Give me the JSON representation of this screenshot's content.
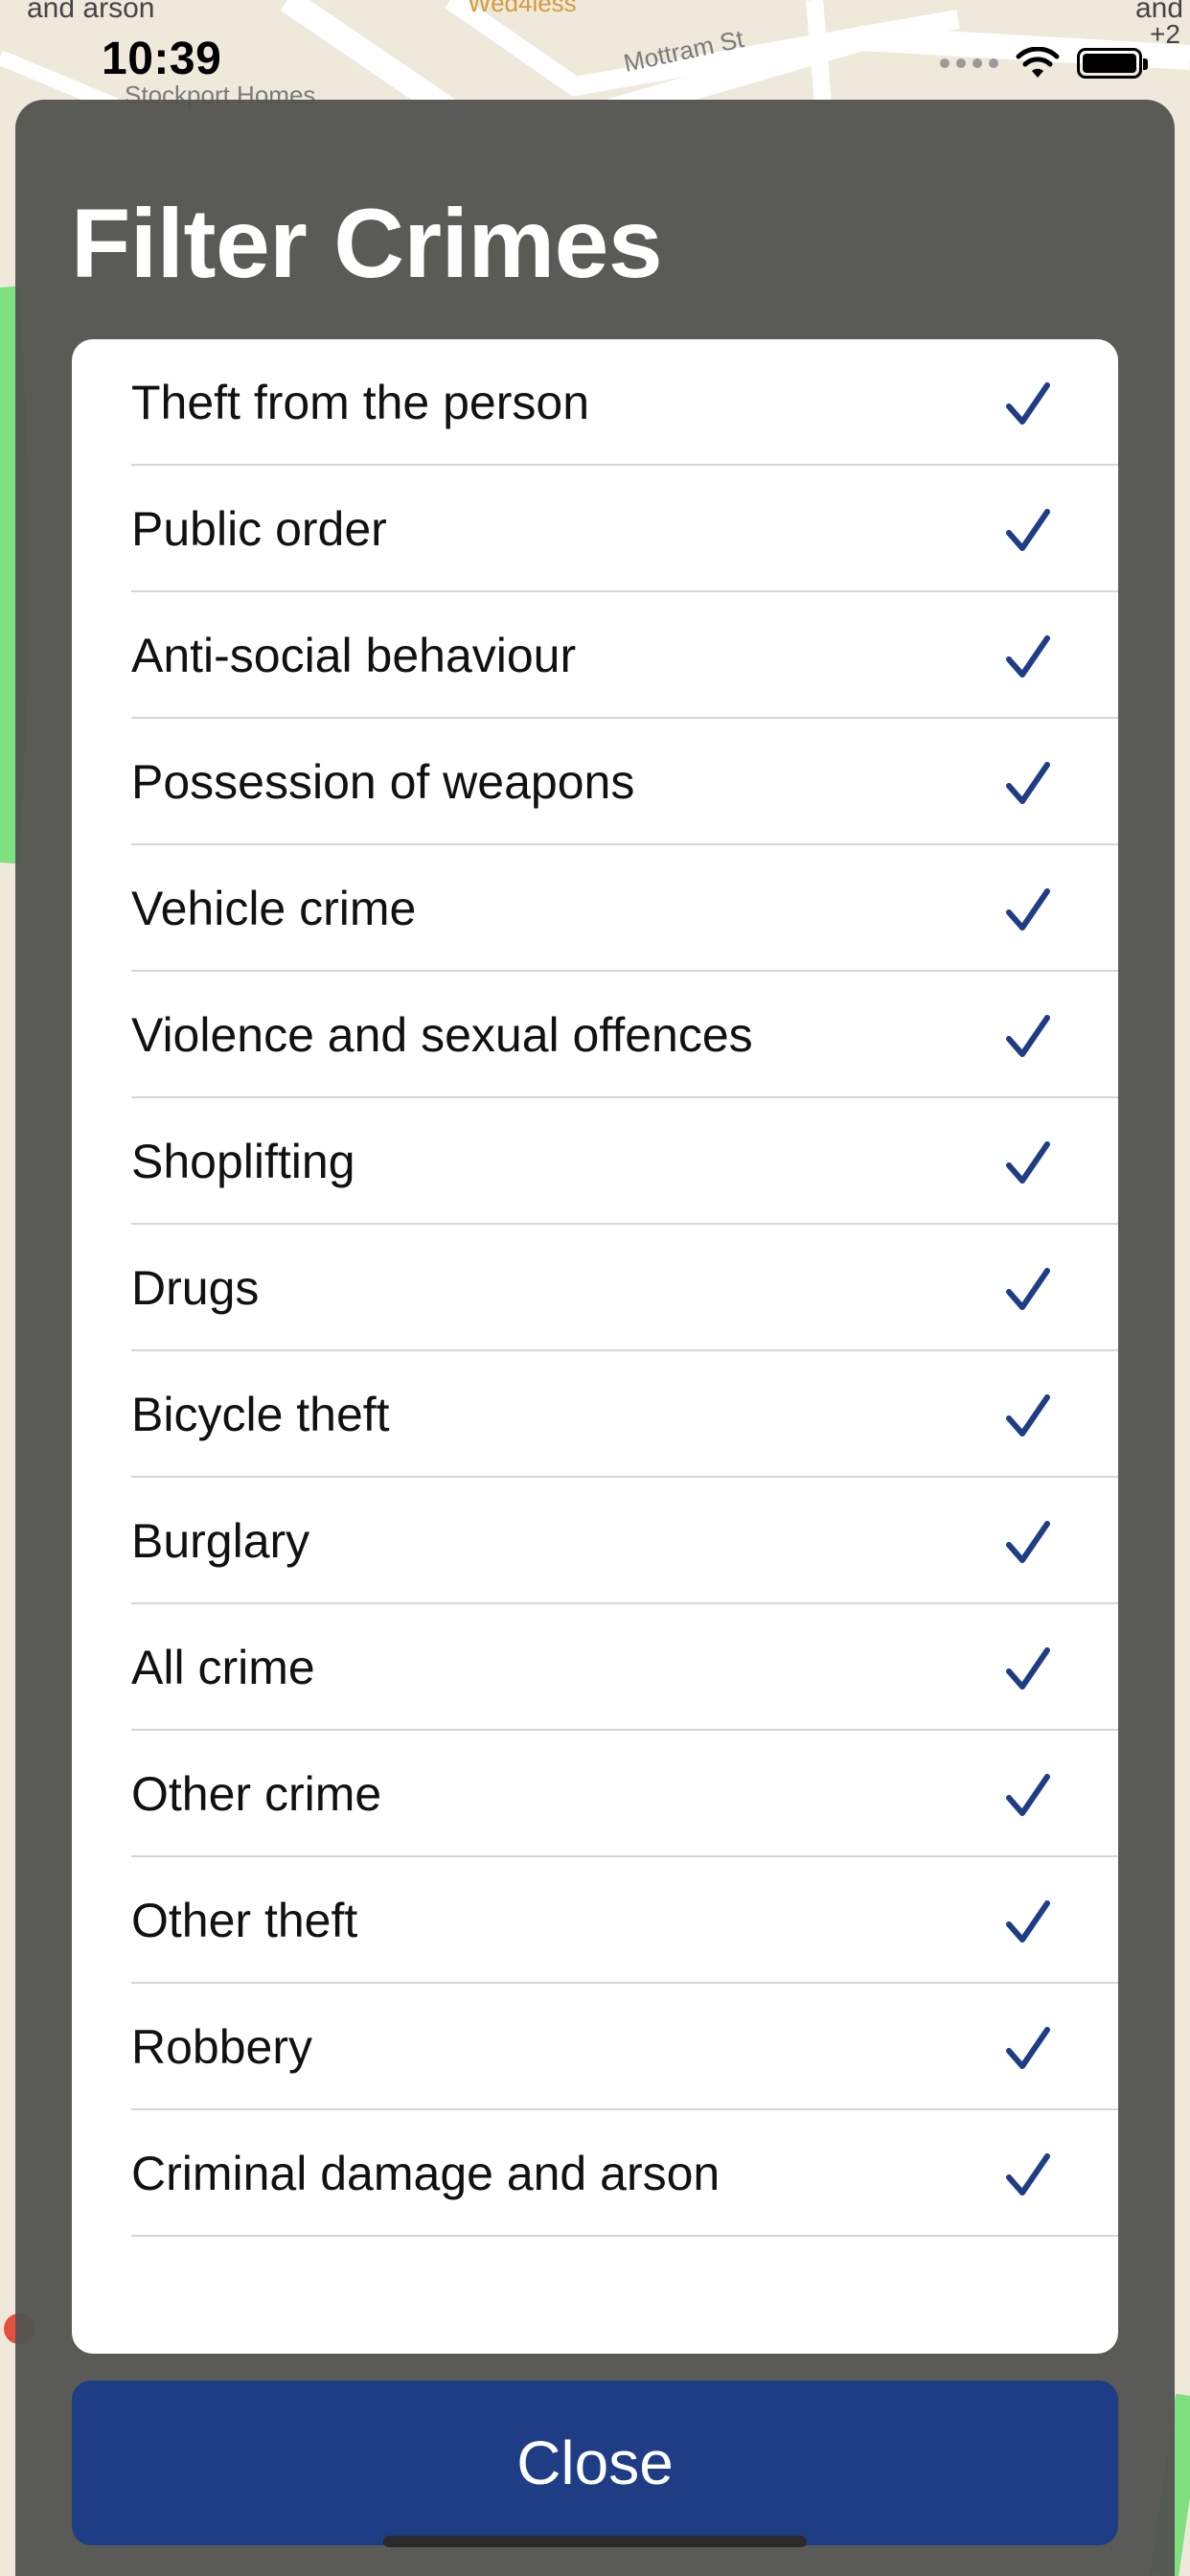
{
  "status_bar": {
    "time": "10:39",
    "wifi_icon": "wifi-icon",
    "battery_icon": "battery-icon"
  },
  "map": {
    "labels": {
      "top_left": "and arson",
      "place": "Stockport Homes",
      "street": "Mottram St",
      "business": "Wed4less",
      "top_right_1": "and",
      "top_right_2": "+2"
    }
  },
  "modal": {
    "title": "Filter Crimes",
    "check_icon": "checkmark-icon",
    "check_color": "#1e3d84",
    "items": [
      {
        "label": "Theft from the person",
        "checked": true
      },
      {
        "label": "Public order",
        "checked": true
      },
      {
        "label": "Anti-social behaviour",
        "checked": true
      },
      {
        "label": "Possession of weapons",
        "checked": true
      },
      {
        "label": "Vehicle crime",
        "checked": true
      },
      {
        "label": "Violence and sexual offences",
        "checked": true
      },
      {
        "label": "Shoplifting",
        "checked": true
      },
      {
        "label": "Drugs",
        "checked": true
      },
      {
        "label": "Bicycle theft",
        "checked": true
      },
      {
        "label": "Burglary",
        "checked": true
      },
      {
        "label": "All crime",
        "checked": true
      },
      {
        "label": "Other crime",
        "checked": true
      },
      {
        "label": "Other theft",
        "checked": true
      },
      {
        "label": "Robbery",
        "checked": true
      },
      {
        "label": "Criminal damage and arson",
        "checked": true
      }
    ],
    "close_label": "Close",
    "close_color": "#1e3d84"
  }
}
